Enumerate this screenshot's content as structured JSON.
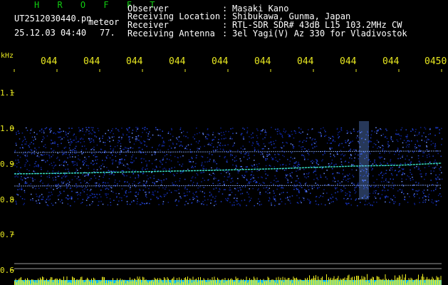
{
  "header": {
    "app_title": "H R O F F T",
    "file_name": "UT2512030440.pn",
    "mode": "meteor",
    "datetime": "25.12.03 04:40",
    "count": "77.",
    "fields": [
      {
        "label": "Observer",
        "value": "Masaki Kano"
      },
      {
        "label": "Receiving Location",
        "value": "Shibukawa, Gunma, Japan"
      },
      {
        "label": "Receiver",
        "value": "RTL-SDR SDR# 43dB L15 103.2MHz CW"
      },
      {
        "label": "Receiving Antenna",
        "value": "3el Yagi(V) Az 330 for Vladivostok"
      }
    ]
  },
  "time_ticks": [
    "044",
    "044",
    "044",
    "044",
    "044",
    "044",
    "044",
    "044",
    "044",
    "0450"
  ],
  "freq_axis": {
    "unit": "kHz",
    "labels": [
      "1.1",
      "1.0",
      "0.9",
      "0.8",
      "0.7",
      "0.6"
    ]
  },
  "colors": {
    "background": "#000000",
    "title": "#11cc11",
    "axis_text": "#e8e820",
    "signal": "#2a5cff",
    "carrier": "#3cf0d0",
    "power_bar": "#f0f020",
    "power_base": "#00b8ff"
  }
}
